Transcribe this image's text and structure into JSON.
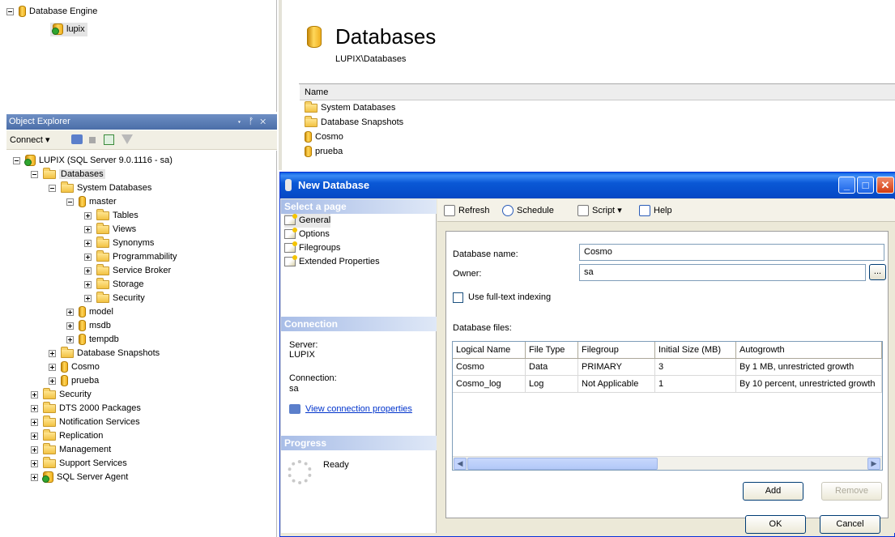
{
  "top_left_tree": {
    "root_label": "Database Engine",
    "child_label": "lupix"
  },
  "object_explorer": {
    "title": "Object Explorer",
    "header_icons": [
      "▾",
      "ᚠ",
      "✕"
    ],
    "connect_label": "Connect ▾",
    "tree": [
      {
        "label": "LUPIX (SQL Server 9.0.1116 - sa)",
        "icon": "server-icon",
        "exp": "minus",
        "indent": 0
      },
      {
        "label": "Databases",
        "icon": "folder-icon",
        "exp": "minus",
        "indent": 1,
        "selected": true
      },
      {
        "label": "System Databases",
        "icon": "folder-icon",
        "exp": "minus",
        "indent": 2
      },
      {
        "label": "master",
        "icon": "database-icon",
        "exp": "minus",
        "indent": 3
      },
      {
        "label": "Tables",
        "icon": "folder-icon",
        "exp": "plus",
        "indent": 4
      },
      {
        "label": "Views",
        "icon": "folder-icon",
        "exp": "plus",
        "indent": 4
      },
      {
        "label": "Synonyms",
        "icon": "folder-icon",
        "exp": "plus",
        "indent": 4
      },
      {
        "label": "Programmability",
        "icon": "folder-icon",
        "exp": "plus",
        "indent": 4
      },
      {
        "label": "Service Broker",
        "icon": "folder-icon",
        "exp": "plus",
        "indent": 4
      },
      {
        "label": "Storage",
        "icon": "folder-icon",
        "exp": "plus",
        "indent": 4
      },
      {
        "label": "Security",
        "icon": "folder-icon",
        "exp": "plus",
        "indent": 4
      },
      {
        "label": "model",
        "icon": "database-icon",
        "exp": "plus",
        "indent": 3
      },
      {
        "label": "msdb",
        "icon": "database-icon",
        "exp": "plus",
        "indent": 3
      },
      {
        "label": "tempdb",
        "icon": "database-icon",
        "exp": "plus",
        "indent": 3
      },
      {
        "label": "Database Snapshots",
        "icon": "folder-icon",
        "exp": "plus",
        "indent": 2
      },
      {
        "label": "Cosmo",
        "icon": "database-icon",
        "exp": "plus",
        "indent": 2
      },
      {
        "label": "prueba",
        "icon": "database-icon",
        "exp": "plus",
        "indent": 2
      },
      {
        "label": "Security",
        "icon": "folder-icon",
        "exp": "plus",
        "indent": 1
      },
      {
        "label": "DTS 2000 Packages",
        "icon": "folder-icon",
        "exp": "plus",
        "indent": 1
      },
      {
        "label": "Notification Services",
        "icon": "folder-icon",
        "exp": "plus",
        "indent": 1
      },
      {
        "label": "Replication",
        "icon": "folder-icon",
        "exp": "plus",
        "indent": 1
      },
      {
        "label": "Management",
        "icon": "folder-icon",
        "exp": "plus",
        "indent": 1
      },
      {
        "label": "Support Services",
        "icon": "folder-icon",
        "exp": "plus",
        "indent": 1
      },
      {
        "label": "SQL Server Agent",
        "icon": "agent-icon",
        "exp": "plus",
        "indent": 1
      }
    ]
  },
  "databases_pane": {
    "title": "Databases",
    "path": "LUPIX\\Databases",
    "column_name": "Name",
    "items": [
      {
        "label": "System Databases",
        "icon": "folder-icon"
      },
      {
        "label": "Database Snapshots",
        "icon": "folder-icon"
      },
      {
        "label": "Cosmo",
        "icon": "database-icon"
      },
      {
        "label": "prueba",
        "icon": "database-icon"
      }
    ]
  },
  "dialog": {
    "title": "New Database",
    "select_page_header": "Select a page",
    "pages": [
      "General",
      "Options",
      "Filegroups",
      "Extended Properties"
    ],
    "connection_header": "Connection",
    "server_label": "Server:",
    "server_value": "LUPIX",
    "connection_label": "Connection:",
    "connection_value": "sa",
    "view_connection_link": "View connection properties",
    "progress_header": "Progress",
    "progress_status": "Ready",
    "toolbar": {
      "refresh": "Refresh",
      "schedule": "Schedule",
      "script": "Script",
      "script_arrow": "▾",
      "help": "Help"
    },
    "database_name_label": "Database name:",
    "database_name_value": "Cosmo",
    "owner_label": "Owner:",
    "owner_value": "sa",
    "browse_label": "...",
    "fulltext_label": "Use full-text indexing",
    "fulltext_checked": false,
    "database_files_label": "Database files:",
    "grid": {
      "columns": [
        "Logical Name",
        "File Type",
        "Filegroup",
        "Initial Size (MB)",
        "Autogrowth"
      ],
      "rows": [
        [
          "Cosmo",
          "Data",
          "PRIMARY",
          "3",
          "By 1 MB, unrestricted growth"
        ],
        [
          "Cosmo_log",
          "Log",
          "Not Applicable",
          "1",
          "By 10 percent, unrestricted growth"
        ]
      ]
    },
    "add_label": "Add",
    "remove_label": "Remove",
    "ok_label": "OK",
    "cancel_label": "Cancel"
  },
  "colors": {
    "titlebar_blue": "#0a58d6",
    "section_header": "#a8bde7",
    "dialog_bg": "#ece9d8"
  }
}
